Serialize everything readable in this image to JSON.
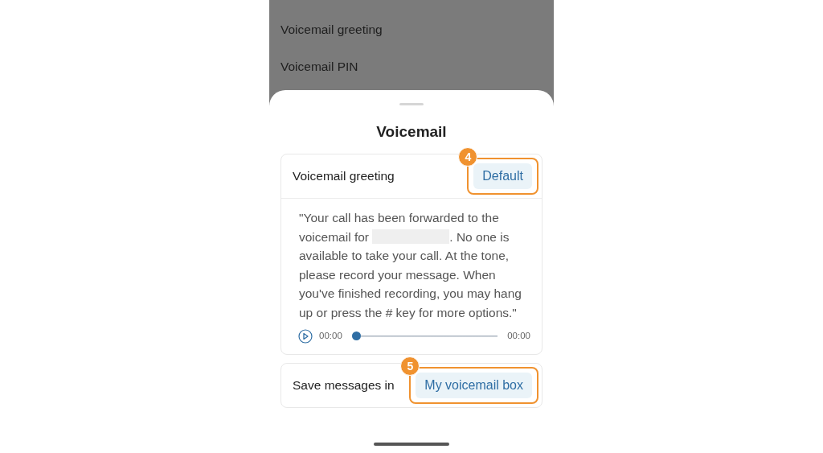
{
  "background_list": {
    "items": [
      "Voicemail greeting",
      "Voicemail PIN"
    ]
  },
  "sheet": {
    "title": "Voicemail",
    "greeting_card": {
      "label": "Voicemail greeting",
      "button": "Default",
      "callout": "4",
      "text_before": "\"Your call has been forwarded to the voicemail for",
      "text_after": ". No one is available to take your call. At the tone, please record your message. When you've finished recording, you may hang up or press the # key for more options.\"",
      "player": {
        "elapsed": "00:00",
        "level": 0,
        "duration": "00:00"
      }
    },
    "save_card": {
      "label": "Save messages in",
      "button": "My voicemail box",
      "callout": "5"
    }
  }
}
